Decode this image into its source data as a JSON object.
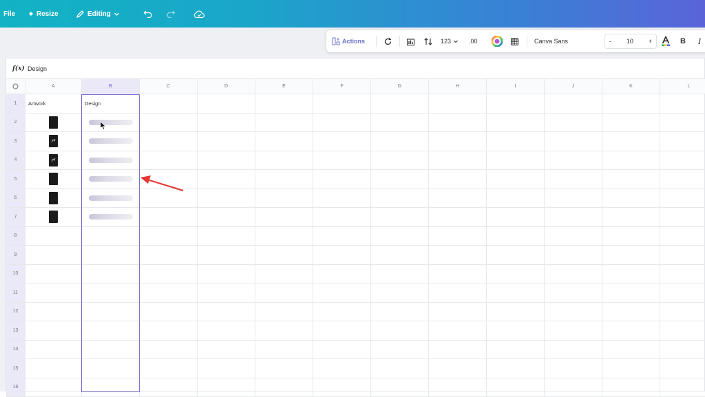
{
  "topbar": {
    "file_label": "File",
    "resize_label": "Resize",
    "editing_label": "Editing"
  },
  "toolbar": {
    "actions_label": "Actions",
    "number_format_label": "123",
    "decimal_label": ".00",
    "font_name": "Canva Sans",
    "font_size": "10",
    "decrease_label": "-",
    "increase_label": "+",
    "bold_label": "B",
    "italic_label": "I"
  },
  "formula_bar": {
    "fx_label": "f(x)",
    "value": "Design"
  },
  "sheet": {
    "corner_icon": "select-all-circle-icon",
    "columns": [
      "A",
      "B",
      "C",
      "D",
      "E",
      "F",
      "G",
      "H",
      "I",
      "J",
      "K",
      "L"
    ],
    "rows": [
      "1",
      "2",
      "3",
      "4",
      "5",
      "6",
      "7",
      "8",
      "9",
      "10",
      "11",
      "12",
      "13",
      "14",
      "15",
      "16"
    ],
    "selected_column": "B",
    "cells": {
      "A1": "Artwork",
      "B1": "Design"
    }
  },
  "colors": {
    "selection": "#7b6fd0",
    "annotation_arrow": "#e53935"
  }
}
